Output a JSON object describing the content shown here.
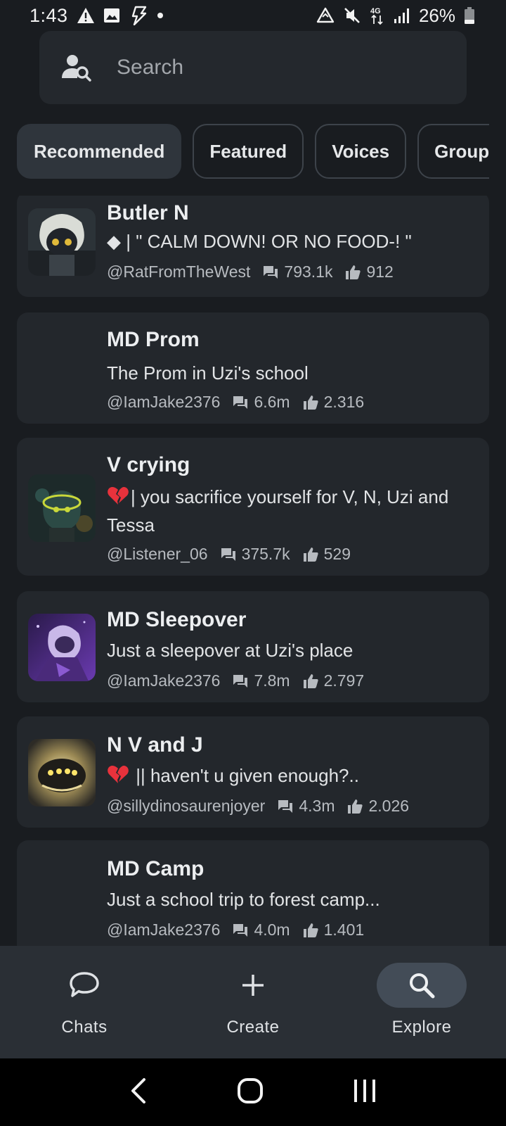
{
  "status_bar": {
    "time": "1:43",
    "network": "4G",
    "battery": "26%"
  },
  "search": {
    "placeholder": "Search"
  },
  "tabs": [
    {
      "label": "Recommended",
      "active": true
    },
    {
      "label": "Featured",
      "active": false
    },
    {
      "label": "Voices",
      "active": false
    },
    {
      "label": "Groups",
      "active": false
    }
  ],
  "cards": [
    {
      "title": "Butler N",
      "description": "◆ | \" CALM DOWN! OR NO FOOD-! \"",
      "author": "@RatFromTheWest",
      "chats": "793.1k",
      "likes": "912",
      "has_avatar": true
    },
    {
      "title": "MD Prom",
      "description": "The Prom in Uzi's school",
      "author": "@IamJake2376",
      "chats": "6.6m",
      "likes": "2.316",
      "has_avatar": false
    },
    {
      "title": "V crying",
      "description": "| you sacrifice yourself for V, N, Uzi and Tessa",
      "author": "@Listener_06",
      "chats": "375.7k",
      "likes": "529",
      "has_avatar": true
    },
    {
      "title": "MD Sleepover",
      "description": "Just a sleepover at Uzi's place",
      "author": "@IamJake2376",
      "chats": "7.8m",
      "likes": "2.797",
      "has_avatar": true
    },
    {
      "title": "N V and J",
      "description": " || haven't u given enough?..",
      "author": "@sillydinosaurenjoyer",
      "chats": "4.3m",
      "likes": "2.026",
      "has_avatar": true
    },
    {
      "title": "MD Camp",
      "description": "Just a school trip to forest camp...",
      "author": "@IamJake2376",
      "chats": "4.0m",
      "likes": "1.401",
      "has_avatar": false
    }
  ],
  "bottom_nav": [
    {
      "label": "Chats",
      "icon": "chat-bubble-icon",
      "active": false
    },
    {
      "label": "Create",
      "icon": "plus-icon",
      "active": false
    },
    {
      "label": "Explore",
      "icon": "search-icon",
      "active": true
    }
  ],
  "colors": {
    "background": "#191c20",
    "card": "#23272c",
    "active_tab": "#2f353c",
    "nav_bar": "#2a2f35",
    "heart_red": "#e8323c"
  }
}
